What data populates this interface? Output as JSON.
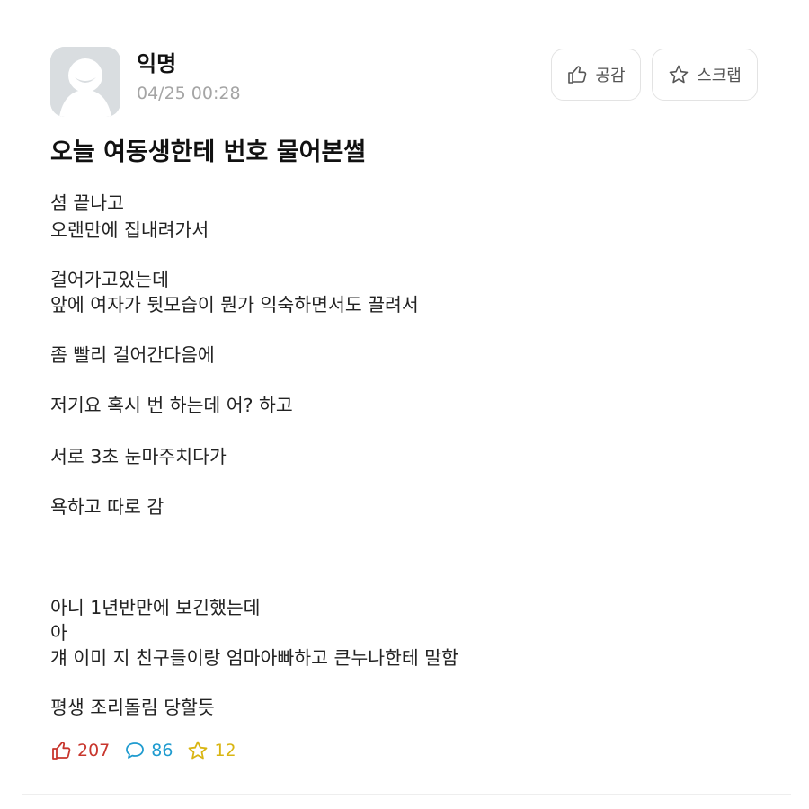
{
  "post": {
    "author": "익명",
    "time": "04/25 00:28",
    "title": "오늘 여동생한테 번호 물어본썰",
    "body_lines": [
      "셤 끝나고",
      "오랜만에 집내려가서",
      "",
      "걸어가고있는데",
      "앞에 여자가 뒷모습이 뭔가 익숙하면서도 끌려서",
      "",
      "좀 빨리 걸어간다음에",
      "",
      "저기요 혹시 번 하는데 어? 하고",
      "",
      "서로 3초 눈마주치다가",
      "",
      "욕하고 따로 감",
      "",
      "",
      "",
      "아니 1년반만에 보긴했는데",
      "아",
      "걔 이미 지 친구들이랑 엄마아빠하고 큰누나한테 말함",
      "",
      "평생 조리돌림 당할듯"
    ]
  },
  "actions": {
    "like_label": "공감",
    "scrap_label": "스크랩"
  },
  "stats": {
    "likes": "207",
    "comments": "86",
    "scraps": "12"
  },
  "colors": {
    "like": "#c8362d",
    "comment": "#1f9bcf",
    "scrap": "#d9b512"
  },
  "icons": {
    "avatar": "default-user-avatar",
    "like": "thumbs-up-icon",
    "scrap": "star-icon",
    "comment": "speech-bubble-icon"
  }
}
